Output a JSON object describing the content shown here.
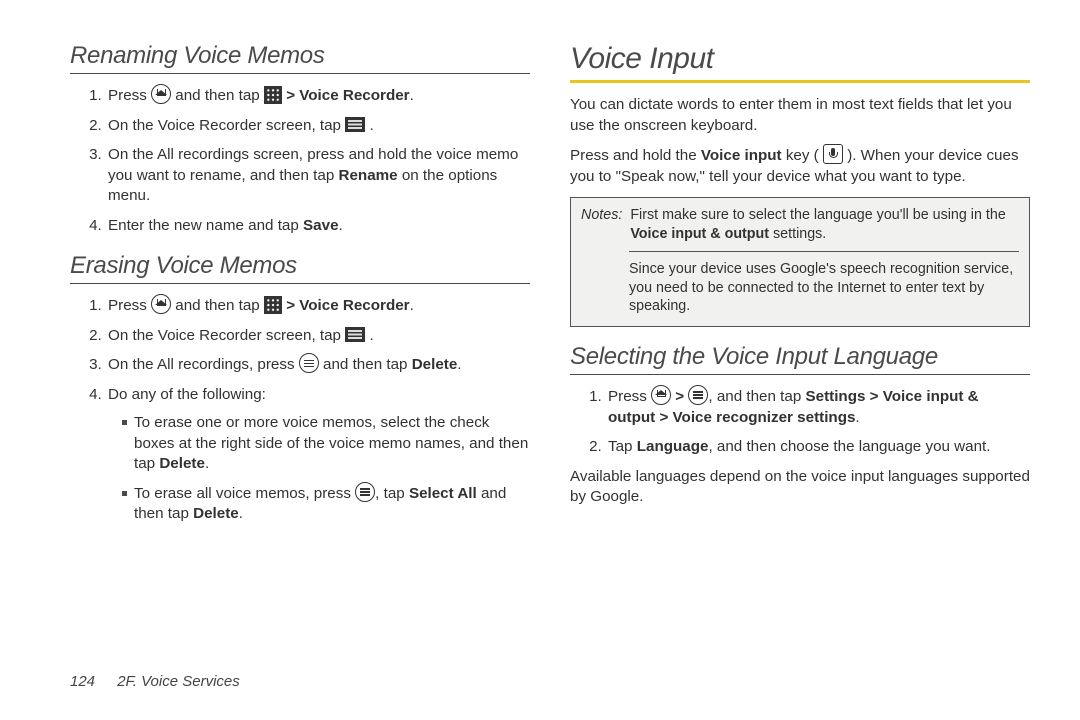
{
  "left": {
    "h1": "Renaming Voice Memos",
    "renaming": {
      "s1a": "Press ",
      "s1b": " and then tap ",
      "s1c": " > ",
      "s1d": "Voice Recorder",
      "s1e": ".",
      "s2a": "On the Voice Recorder screen, tap ",
      "s2b": ".",
      "s3a": "On the All recordings screen, press and hold the voice memo you want to rename, and then tap ",
      "s3b": "Rename",
      "s3c": " on the options menu.",
      "s4a": "Enter the new name and tap ",
      "s4b": "Save",
      "s4c": "."
    },
    "h2": "Erasing Voice Memos",
    "erasing": {
      "s1a": "Press ",
      "s1b": " and then tap ",
      "s1c": " > ",
      "s1d": "Voice Recorder",
      "s1e": ".",
      "s2a": "On the Voice Recorder screen, tap ",
      "s2b": ".",
      "s3a": "On the All recordings, press ",
      "s3b": " and then tap ",
      "s3c": "Delete",
      "s3d": ".",
      "s4": "Do any of the following:",
      "b1a": "To erase one or more voice memos, select the check boxes at the right side of the voice memo names, and then tap ",
      "b1b": "Delete",
      "b1c": ".",
      "b2a": "To erase all voice memos, press ",
      "b2b": ", tap ",
      "b2c": "Select All",
      "b2d": " and then tap ",
      "b2e": "Delete",
      "b2f": "."
    }
  },
  "right": {
    "h1": "Voice Input",
    "p1": "You can dictate words to enter them in most text fields that let you use the onscreen keyboard.",
    "p2a": "Press and hold the ",
    "p2b": "Voice input",
    "p2c": " key ( ",
    "p2d": " ). When your device cues you to \"Speak now,\" tell your device what you want to type.",
    "notes": {
      "label": "Notes:",
      "n1a": "First make sure to select the language you'll be using in the ",
      "n1b": "Voice input & output",
      "n1c": " settings.",
      "n2": "Since your device uses Google's speech recognition service, you need to be connected to the Internet to enter text by speaking."
    },
    "h2": "Selecting the Voice Input Language",
    "sel": {
      "s1a": "Press ",
      "s1b": " > ",
      "s1c": ", and then tap ",
      "s1d": "Settings",
      "s1e": " > ",
      "s1f": "Voice input & output",
      "s1g": " > ",
      "s1h": "Voice recognizer settings",
      "s1i": ".",
      "s2a": "Tap ",
      "s2b": "Language",
      "s2c": ", and then choose the language you want."
    },
    "p3": "Available languages depend on the voice input languages supported by Google."
  },
  "footer": {
    "page": "124",
    "section": "2F. Voice Services"
  }
}
